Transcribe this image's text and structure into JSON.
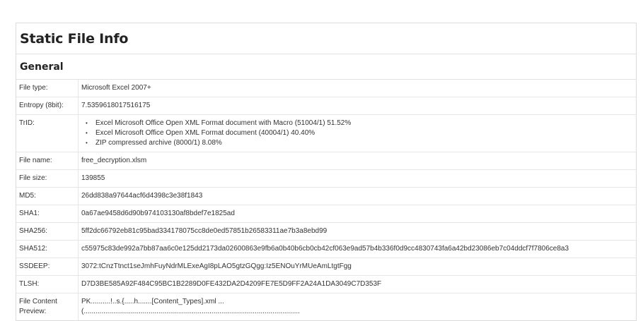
{
  "panel": {
    "title": "Static File Info"
  },
  "general": {
    "section_title": "General",
    "rows": {
      "file_type": {
        "label": "File type:",
        "value": "Microsoft Excel 2007+"
      },
      "entropy": {
        "label": "Entropy (8bit):",
        "value": "7.5359618017516175"
      },
      "trid": {
        "label": "TrID:",
        "items": [
          "Excel Microsoft Office Open XML Format document with Macro (51004/1) 51.52%",
          "Excel Microsoft Office Open XML Format document (40004/1) 40.40%",
          "ZIP compressed archive (8000/1) 8.08%"
        ]
      },
      "file_name": {
        "label": "File name:",
        "value": "free_decryption.xlsm"
      },
      "file_size": {
        "label": "File size:",
        "value": "139855"
      },
      "md5": {
        "label": "MD5:",
        "value": "26dd838a97644acf6d4398c3e38f1843"
      },
      "sha1": {
        "label": "SHA1:",
        "value": "0a67ae9458d6d90b974103130af8bdef7e1825ad"
      },
      "sha256": {
        "label": "SHA256:",
        "value": "5ff2dc66792eb81c95bad334178075cc8de0ed57851b26583311ae7b3a8ebd99"
      },
      "sha512": {
        "label": "SHA512:",
        "value": "c55975c83de992a7bb87aa6c0e125dd2173da02600863e9fb6a0b40b6cb0cb42cf063e9ad57b4b336f0d9cc4830743fa6a42bd23086eb7c04ddcf7f7806ce8a3"
      },
      "ssdeep": {
        "label": "SSDEEP:",
        "value": "3072:tCnzTtnct1seJmhFuyNdrMLExeAgI8pLAO5gtzGQgg:Iz5ENOuYrMUeAmLtgtFgg"
      },
      "tlsh": {
        "label": "TLSH:",
        "value": "D7D3BE585A92F484C95BC1B2289D0FE432DA2D4209FE7E5D9FF2A24A1DA3049C7D353F"
      },
      "preview": {
        "label": "File Content Preview:",
        "line1": "PK..........!..s.{.....h.......[Content_Types].xml ...",
        "line2": "(.............................................................................................................."
      }
    }
  },
  "icons": {
    "bullet": "•"
  }
}
